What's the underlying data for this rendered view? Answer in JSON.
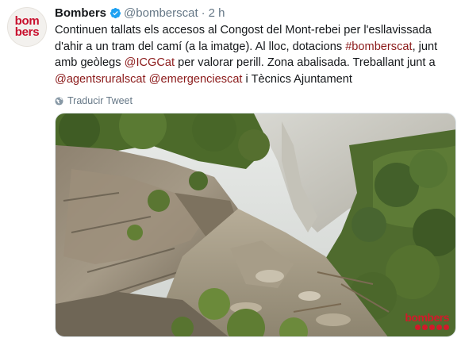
{
  "avatar": {
    "line1": "bom",
    "line2": "bers"
  },
  "tweet": {
    "name": "Bombers",
    "handle": "@bomberscat",
    "separator": "·",
    "time": "2 h",
    "text_parts": {
      "p1": "Continuen tallats els accesos al Congost del Mont-rebei per l'esllavissada d'ahir a un tram del camí (a la imatge). Al lloc, dotacions ",
      "hashtag": "#bomberscat",
      "p2": ", junt amb geòlegs ",
      "mention_icg": "@ICGCat",
      "p3": " per valorar perill. Zona abalisada. Treballant junt a ",
      "mention_agents": "@agentsruralscat",
      "p4": " ",
      "mention_emerg": "@emergenciescat",
      "p5": " i Tècnics Ajuntament"
    },
    "translate_label": "Traducir Tweet"
  },
  "media": {
    "watermark": "bombers"
  },
  "colors": {
    "link": "#8b1a1a",
    "verified": "#1da1f2",
    "brand": "#c8102e"
  }
}
